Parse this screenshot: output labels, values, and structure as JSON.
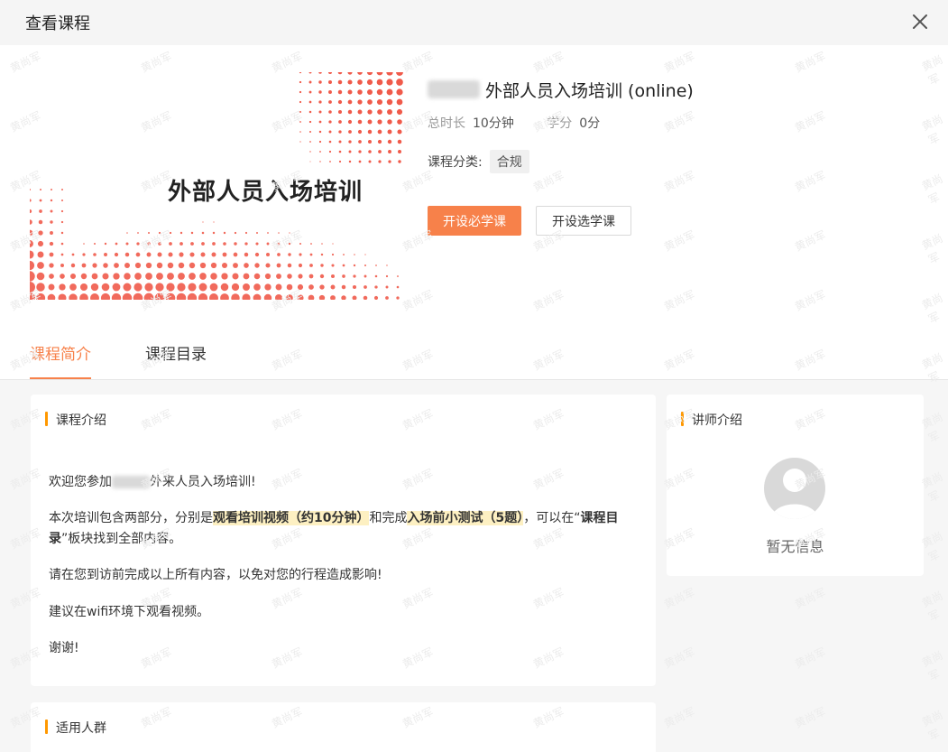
{
  "window": {
    "title": "查看课程"
  },
  "course": {
    "title_suffix": "外部人员入场培训 (online)",
    "cover_text": "外部人员入场培训",
    "duration_label": "总时长",
    "duration_value": "10分钟",
    "credit_label": "学分",
    "credit_value": "0分",
    "category_label": "课程分类:",
    "category_value": "合规"
  },
  "actions": {
    "required_label": "开设必学课",
    "elective_label": "开设选学课"
  },
  "tabs": [
    {
      "label": "课程简介",
      "active": true
    },
    {
      "label": "课程目录",
      "active": false
    }
  ],
  "intro": {
    "title": "课程介绍",
    "p1_pre": "欢迎您参加",
    "p1_post": "外来人员入场培训!",
    "p2_a": "本次培训包含两部分，分别是",
    "p2_hl1": "观看培训视频（约10分钟）",
    "p2_b": "和完成",
    "p2_hl2": "入场前小测试（5题）",
    "p2_c": "，可以在“",
    "p2_link": "课程目录",
    "p2_d": "”板块找到全部内容。",
    "p3": "请在您到访前完成以上所有内容，以免对您的行程造成影响!",
    "p4": "建议在wifi环境下观看视频。",
    "p5": "谢谢!"
  },
  "lecturer": {
    "title": "讲师介绍",
    "empty": "暂无信息"
  },
  "audience": {
    "title": "适用人群"
  },
  "watermark": "黄尚军",
  "colors": {
    "accent": "#f7814a",
    "bar": "#ff9800",
    "cover_dots": "#f05a4a"
  }
}
